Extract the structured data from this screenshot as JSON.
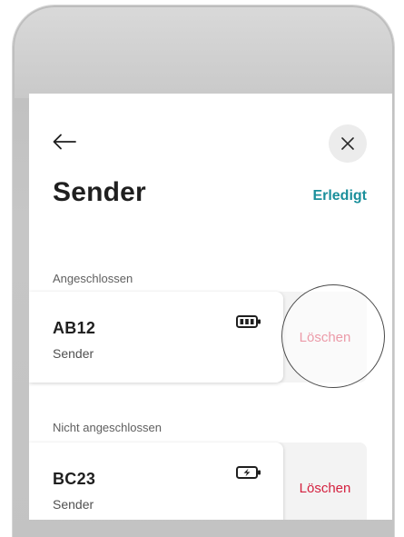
{
  "header": {
    "back_icon": "arrow-left-icon",
    "close_icon": "close-icon",
    "title": "Sender",
    "done_label": "Erledigt"
  },
  "sections": [
    {
      "label": "Angeschlossen",
      "items": [
        {
          "name": "AB12",
          "subtitle": "Sender",
          "icon": "battery-full-icon",
          "delete_label": "Löschen"
        }
      ]
    },
    {
      "label": "Nicht angeschlossen",
      "items": [
        {
          "name": "BC23",
          "subtitle": "Sender",
          "icon": "battery-charging-icon",
          "delete_label": "Löschen"
        }
      ]
    }
  ],
  "colors": {
    "accent": "#1a8f9b",
    "delete": "#d4213f",
    "frame": "#c3c3c3"
  }
}
